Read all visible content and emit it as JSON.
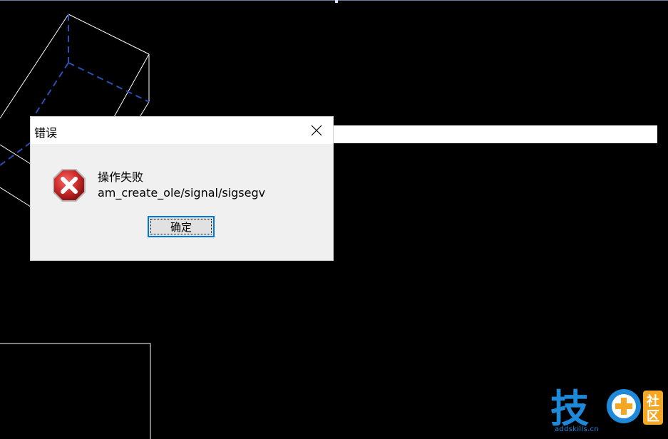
{
  "dialog": {
    "title": "错误",
    "message_title": "操作失败",
    "message_detail": "am_create_ole/signal/sigsegv",
    "ok_label": "确定",
    "icons": {
      "close": "close-icon",
      "error": "error-icon"
    }
  },
  "watermark": {
    "char_main": "技",
    "char_side_top": "社",
    "char_side_bottom": "区",
    "domain": "addskills.cn"
  },
  "colors": {
    "background": "#000000",
    "dialog_bg": "#f0f0f0",
    "titlebar_bg": "#ffffff",
    "button_focus_border": "#0078d7",
    "error_red": "#d32f2f",
    "watermark_blue": "#1e88d9",
    "watermark_orange": "#f5a623",
    "cad_line_white": "#ffffff",
    "cad_line_dashed_blue": "#2a4fb5"
  }
}
